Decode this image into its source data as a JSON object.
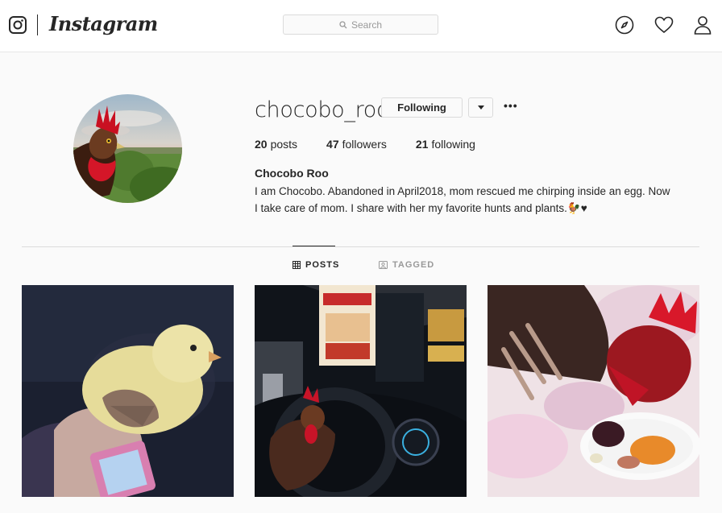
{
  "header": {
    "brand": "Instagram",
    "search_placeholder": "Search",
    "icons": [
      "instagram-logo-icon",
      "search-icon",
      "compass-icon",
      "heart-icon",
      "profile-icon"
    ]
  },
  "profile": {
    "username": "chocobo_roo",
    "follow_label": "Following",
    "more_label": "•••",
    "stats": {
      "posts_count": "20",
      "posts_label": "posts",
      "followers_count": "47",
      "followers_label": "followers",
      "following_count": "21",
      "following_label": "following"
    },
    "full_name": "Chocobo Roo",
    "bio_line1": "I am Chocobo. Abandoned in April2018, mom rescued me chirping inside an egg. Now",
    "bio_line2": "I take care of mom. I share with her my favorite hunts and plants.🐓♥"
  },
  "tabs": [
    {
      "label": "POSTS",
      "active": true
    },
    {
      "label": "TAGGED",
      "active": false
    }
  ],
  "posts": [
    {
      "subject": "yellow chick held in hand"
    },
    {
      "subject": "rooster on car steering wheel at drive-thru"
    },
    {
      "subject": "rooster eating from plate on blanket"
    }
  ],
  "colors": {
    "background": "#fafafa",
    "text": "#262626",
    "muted": "#999999",
    "border": "#dbdbdb"
  }
}
